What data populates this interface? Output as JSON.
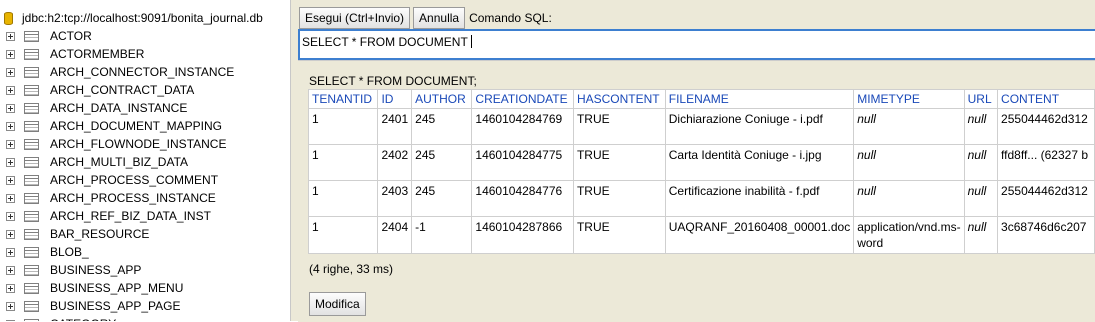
{
  "connection": {
    "url": "jdbc:h2:tcp://localhost:9091/bonita_journal.db"
  },
  "tables": [
    "ACTOR",
    "ACTORMEMBER",
    "ARCH_CONNECTOR_INSTANCE",
    "ARCH_CONTRACT_DATA",
    "ARCH_DATA_INSTANCE",
    "ARCH_DOCUMENT_MAPPING",
    "ARCH_FLOWNODE_INSTANCE",
    "ARCH_MULTI_BIZ_DATA",
    "ARCH_PROCESS_COMMENT",
    "ARCH_PROCESS_INSTANCE",
    "ARCH_REF_BIZ_DATA_INST",
    "BAR_RESOURCE",
    "BLOB_",
    "BUSINESS_APP",
    "BUSINESS_APP_MENU",
    "BUSINESS_APP_PAGE",
    "CATEGORY"
  ],
  "toolbar": {
    "run_label": "Esegui (Ctrl+Invio)",
    "cancel_label": "Annulla",
    "sql_label": "Comando SQL:"
  },
  "sql": {
    "text": "SELECT * FROM DOCUMENT"
  },
  "results": {
    "query": "SELECT * FROM DOCUMENT;",
    "columns": [
      "TENANTID",
      "ID",
      "AUTHOR",
      "CREATIONDATE",
      "HASCONTENT",
      "FILENAME",
      "MIMETYPE",
      "URL",
      "CONTENT"
    ],
    "rows": [
      [
        "1",
        "2401",
        "245",
        "1460104284769",
        "TRUE",
        "Dichiarazione Coniuge - i.pdf",
        "null",
        "null",
        "255044462d312"
      ],
      [
        "1",
        "2402",
        "245",
        "1460104284775",
        "TRUE",
        "Carta Identità Coniuge - i.jpg",
        "null",
        "null",
        "ffd8ff... (62327 b"
      ],
      [
        "1",
        "2403",
        "245",
        "1460104284776",
        "TRUE",
        "Certificazione inabilità - f.pdf",
        "null",
        "null",
        "255044462d312"
      ],
      [
        "1",
        "2404",
        "-1",
        "1460104287866",
        "TRUE",
        "UAQRANF_20160408_00001.doc",
        "application/vnd.ms-word",
        "null",
        "3c68746d6c207"
      ]
    ],
    "row_count": "(4 righe, 33 ms)",
    "edit_label": "Modifica"
  }
}
